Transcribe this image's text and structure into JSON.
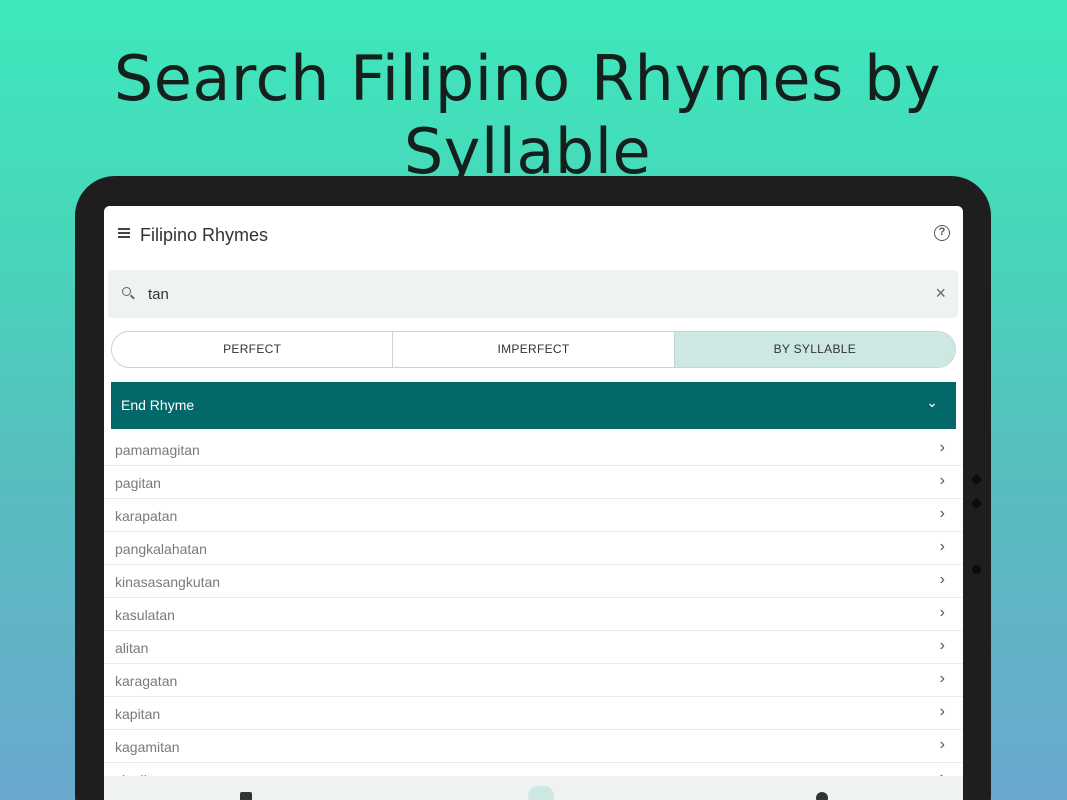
{
  "headline": "Search Filipino Rhymes by Syllable",
  "app": {
    "title": "Filipino Rhymes",
    "menu_icon": "menu-icon",
    "help_icon": "help-icon",
    "help_glyph": "?"
  },
  "search": {
    "value": "tan",
    "placeholder": "",
    "clear_glyph": "×"
  },
  "tabs": [
    {
      "label": "PERFECT",
      "active": false
    },
    {
      "label": "IMPERFECT",
      "active": false
    },
    {
      "label": "BY SYLLABLE",
      "active": true
    }
  ],
  "section": {
    "title": "End Rhyme",
    "chevron": "⌄"
  },
  "results": [
    "pamamagitan",
    "pagitan",
    "karapatan",
    "pangkalahatan",
    "kinasasangkutan",
    "kasulatan",
    "alitan",
    "karagatan",
    "kapitan",
    "kagamitan",
    "sigalitan"
  ],
  "row_chevron": "›",
  "colors": {
    "accent": "#04676a",
    "active_tab": "#cde7e2",
    "background_top": "#3ee8bc",
    "background_bottom": "#6aa8cf"
  }
}
